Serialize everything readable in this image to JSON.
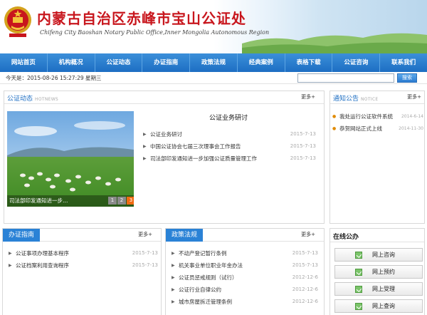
{
  "header": {
    "title": "内蒙古自治区赤峰市宝山公证处",
    "subtitle": "Chifeng City Baoshan Notary Public Office,Inner Mongolia Autonomous Region"
  },
  "nav": [
    "网站首页",
    "机构概况",
    "公证动态",
    "办证指南",
    "政策法规",
    "经典案例",
    "表格下载",
    "公证咨询",
    "联系我们"
  ],
  "bar": {
    "date": "今天是：2015-08-26 15:27:29 星期三",
    "search_placeholder": "",
    "search_label": "搜索"
  },
  "news": {
    "title": "公证动态",
    "title_en": "HOTNEWS",
    "more": "更多+",
    "featured": "公证业务研讨",
    "items": [
      {
        "title": "公证业务研讨",
        "date": "2015-7-13"
      },
      {
        "title": "中国公证协会七届三次理事会工作报告",
        "date": "2015-7-13"
      },
      {
        "title": "司法部印发通知进一步加强公证质量管理工作",
        "date": "2015-7-13"
      }
    ],
    "slide_caption": "司法部印发通知进一步…",
    "pager": [
      "1",
      "2",
      "3"
    ]
  },
  "notice": {
    "title": "通知公告",
    "title_en": "NOTICE",
    "more": "更多+",
    "items": [
      {
        "title": "我处运行公证软件系统",
        "date": "2014-6-14"
      },
      {
        "title": "恭贺网站正式上线",
        "date": "2014-11-30"
      }
    ]
  },
  "guide": {
    "title": "办证指南",
    "more": "更多+",
    "items": [
      {
        "title": "公证事项办理基本程序",
        "date": "2015-7-13"
      },
      {
        "title": "公证档案利用查询程序",
        "date": "2015-7-13"
      }
    ]
  },
  "policy": {
    "title": "政策法规",
    "more": "更多+",
    "items": [
      {
        "title": "不动产登记暂行条例",
        "date": "2015-7-13"
      },
      {
        "title": "机关事业单位职业年金办法",
        "date": "2015-7-13"
      },
      {
        "title": "公证员惩戒规则（试行）",
        "date": "2012-12-6"
      },
      {
        "title": "公证行业自律公约",
        "date": "2012-12-6"
      },
      {
        "title": "城市房屋拆迁管理条例",
        "date": "2012-12-6"
      }
    ]
  },
  "online": {
    "title": "在线公办",
    "buttons": [
      "网上咨询",
      "网上预约",
      "网上受理",
      "网上查询"
    ]
  },
  "colors": {
    "brand_red": "#c8161d",
    "nav_blue": "#1d6ec3",
    "accent_orange": "#f06a12"
  }
}
